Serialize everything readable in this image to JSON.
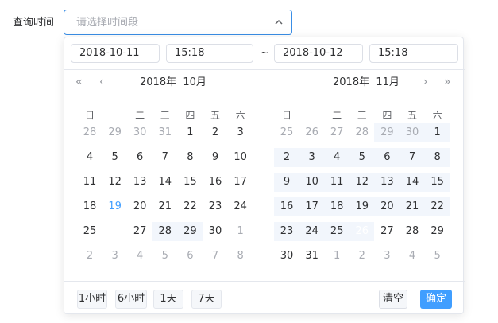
{
  "form": {
    "label": "查询时间",
    "placeholder": "请选择时间段"
  },
  "inputs": {
    "start_date": "2018-10-11",
    "start_time": "15:18",
    "separator": "~",
    "end_date": "2018-10-12",
    "end_time": "15:18"
  },
  "left_calendar": {
    "year": "2018年",
    "month": "10月",
    "weekdays": [
      "日",
      "一",
      "二",
      "三",
      "四",
      "五",
      "六"
    ],
    "weeks": [
      [
        {
          "d": "28",
          "t": "muted"
        },
        {
          "d": "29",
          "t": "muted"
        },
        {
          "d": "30",
          "t": "muted"
        },
        {
          "d": "31",
          "t": "muted"
        },
        {
          "d": "1",
          "t": "normal"
        },
        {
          "d": "2",
          "t": "normal"
        },
        {
          "d": "3",
          "t": "normal"
        }
      ],
      [
        {
          "d": "4",
          "t": "normal"
        },
        {
          "d": "5",
          "t": "normal"
        },
        {
          "d": "6",
          "t": "normal"
        },
        {
          "d": "7",
          "t": "normal"
        },
        {
          "d": "8",
          "t": "normal"
        },
        {
          "d": "9",
          "t": "normal"
        },
        {
          "d": "10",
          "t": "normal"
        }
      ],
      [
        {
          "d": "11",
          "t": "normal"
        },
        {
          "d": "12",
          "t": "normal"
        },
        {
          "d": "13",
          "t": "normal"
        },
        {
          "d": "14",
          "t": "normal"
        },
        {
          "d": "15",
          "t": "normal"
        },
        {
          "d": "16",
          "t": "normal"
        },
        {
          "d": "17",
          "t": "normal"
        }
      ],
      [
        {
          "d": "18",
          "t": "normal"
        },
        {
          "d": "19",
          "t": "today"
        },
        {
          "d": "20",
          "t": "normal"
        },
        {
          "d": "21",
          "t": "normal"
        },
        {
          "d": "22",
          "t": "normal"
        },
        {
          "d": "23",
          "t": "normal"
        },
        {
          "d": "24",
          "t": "normal"
        }
      ],
      [
        {
          "d": "25",
          "t": "normal"
        },
        {
          "d": "26",
          "t": "active"
        },
        {
          "d": "27",
          "t": "normal"
        },
        {
          "d": "28",
          "t": "normal"
        },
        {
          "d": "29",
          "t": "normal"
        },
        {
          "d": "30",
          "t": "normal"
        },
        {
          "d": "1",
          "t": "muted"
        }
      ],
      [
        {
          "d": "2",
          "t": "muted"
        },
        {
          "d": "3",
          "t": "muted"
        },
        {
          "d": "4",
          "t": "muted"
        },
        {
          "d": "5",
          "t": "muted"
        },
        {
          "d": "6",
          "t": "muted"
        },
        {
          "d": "7",
          "t": "muted"
        },
        {
          "d": "8",
          "t": "muted"
        }
      ]
    ]
  },
  "right_calendar": {
    "year": "2018年",
    "month": "11月",
    "weekdays": [
      "日",
      "一",
      "二",
      "三",
      "四",
      "五",
      "六"
    ],
    "weeks": [
      [
        {
          "d": "25",
          "t": "muted"
        },
        {
          "d": "26",
          "t": "muted"
        },
        {
          "d": "27",
          "t": "muted"
        },
        {
          "d": "28",
          "t": "muted"
        },
        {
          "d": "29",
          "t": "muted"
        },
        {
          "d": "30",
          "t": "muted"
        },
        {
          "d": "1",
          "t": "normal"
        }
      ],
      [
        {
          "d": "2",
          "t": "normal"
        },
        {
          "d": "3",
          "t": "normal"
        },
        {
          "d": "4",
          "t": "normal"
        },
        {
          "d": "5",
          "t": "normal"
        },
        {
          "d": "6",
          "t": "normal"
        },
        {
          "d": "7",
          "t": "normal"
        },
        {
          "d": "8",
          "t": "normal"
        }
      ],
      [
        {
          "d": "9",
          "t": "normal"
        },
        {
          "d": "10",
          "t": "normal"
        },
        {
          "d": "11",
          "t": "normal"
        },
        {
          "d": "12",
          "t": "normal"
        },
        {
          "d": "13",
          "t": "normal"
        },
        {
          "d": "14",
          "t": "normal"
        },
        {
          "d": "15",
          "t": "normal"
        }
      ],
      [
        {
          "d": "16",
          "t": "normal"
        },
        {
          "d": "17",
          "t": "normal"
        },
        {
          "d": "18",
          "t": "normal"
        },
        {
          "d": "19",
          "t": "normal"
        },
        {
          "d": "20",
          "t": "normal"
        },
        {
          "d": "21",
          "t": "normal"
        },
        {
          "d": "22",
          "t": "normal"
        }
      ],
      [
        {
          "d": "23",
          "t": "normal"
        },
        {
          "d": "24",
          "t": "normal"
        },
        {
          "d": "25",
          "t": "normal"
        },
        {
          "d": "26",
          "t": "active"
        },
        {
          "d": "27",
          "t": "normal"
        },
        {
          "d": "28",
          "t": "normal"
        },
        {
          "d": "29",
          "t": "normal"
        }
      ],
      [
        {
          "d": "30",
          "t": "normal"
        },
        {
          "d": "31",
          "t": "normal"
        },
        {
          "d": "1",
          "t": "muted"
        },
        {
          "d": "2",
          "t": "muted"
        },
        {
          "d": "3",
          "t": "muted"
        },
        {
          "d": "4",
          "t": "muted"
        },
        {
          "d": "5",
          "t": "muted"
        }
      ]
    ]
  },
  "range_highlight": {
    "left": [
      [
        4,
        3,
        4
      ]
    ],
    "right": [
      [
        0,
        4,
        6
      ],
      [
        1,
        0,
        6
      ],
      [
        2,
        0,
        6
      ],
      [
        3,
        0,
        6
      ],
      [
        4,
        0,
        3
      ]
    ]
  },
  "shortcuts": [
    "1小时",
    "6小时",
    "1天",
    "7天"
  ],
  "buttons": {
    "clear": "清空",
    "confirm": "确定"
  },
  "colors": {
    "accent": "#409eff",
    "range_bg": "#f2f6fc",
    "muted": "#a8abb2",
    "border": "#e4e7ed"
  },
  "icons": {
    "prev_year": "double-chevron-left-icon",
    "prev_month": "chevron-left-icon",
    "next_month": "chevron-right-icon",
    "next_year": "double-chevron-right-icon",
    "toggle": "chevron-up-icon"
  }
}
